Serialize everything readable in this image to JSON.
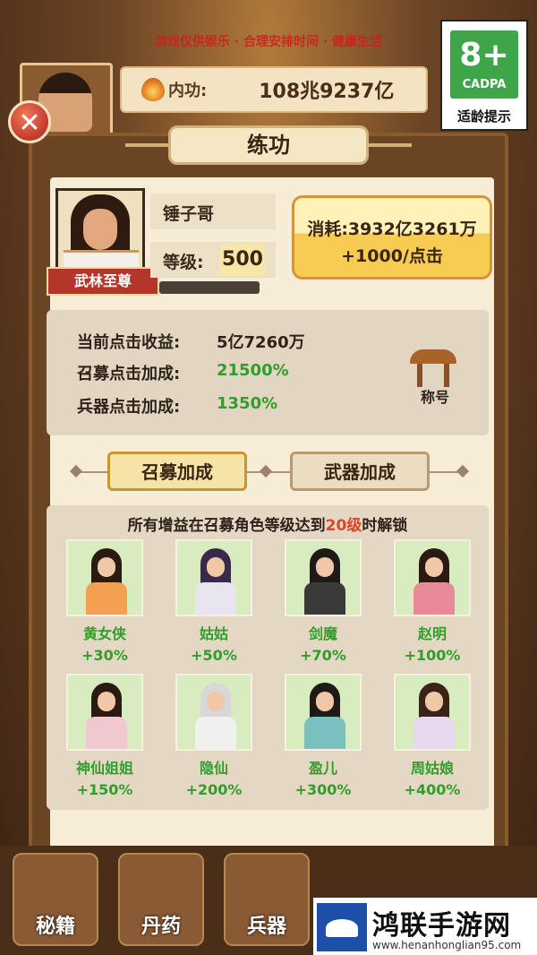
{
  "top": {
    "banner_text": "游戏仅供娱乐 · 合理安排时间 · 健康生活",
    "neigong_label": "内功:",
    "neigong_value": "108兆9237亿"
  },
  "rating": {
    "age": "8+",
    "org": "CADPA",
    "tip": "适龄提示",
    "color": "#3ea548"
  },
  "panel": {
    "title": "练功",
    "hero": {
      "name": "锤子哥",
      "level_label": "等级:",
      "level_value": "500",
      "rank_title": "武林至尊"
    },
    "cost_button": {
      "line1": "消耗:3932亿3261万",
      "line2": "+1000/点击"
    },
    "stats": [
      {
        "label": "当前点击收益:",
        "value": "5亿7260万"
      },
      {
        "label": "召募点击加成:",
        "value": "21500%"
      },
      {
        "label": "兵器点击加成:",
        "value": "1350%"
      }
    ],
    "title_icon_label": "称号",
    "tabs": [
      {
        "label": "召募加成",
        "active": true
      },
      {
        "label": "武器加成",
        "active": false
      }
    ],
    "unlock_note": {
      "prefix": "所有增益在召募角色等级达到",
      "highlight": "20级",
      "suffix": "时解锁"
    },
    "characters": [
      {
        "name": "黄女侠",
        "bonus": "+30%"
      },
      {
        "name": "姑姑",
        "bonus": "+50%"
      },
      {
        "name": "剑魔",
        "bonus": "+70%"
      },
      {
        "name": "赵明",
        "bonus": "+100%"
      },
      {
        "name": "神仙姐姐",
        "bonus": "+150%"
      },
      {
        "name": "隐仙",
        "bonus": "+200%"
      },
      {
        "name": "盈儿",
        "bonus": "+300%"
      },
      {
        "name": "周姑娘",
        "bonus": "+400%"
      }
    ]
  },
  "bottom_nav": [
    {
      "label": "秘籍"
    },
    {
      "label": "丹药"
    },
    {
      "label": "兵器"
    }
  ],
  "watermark": {
    "brand": "鸿联手游网",
    "url": "www.henanhonglian95.com"
  }
}
